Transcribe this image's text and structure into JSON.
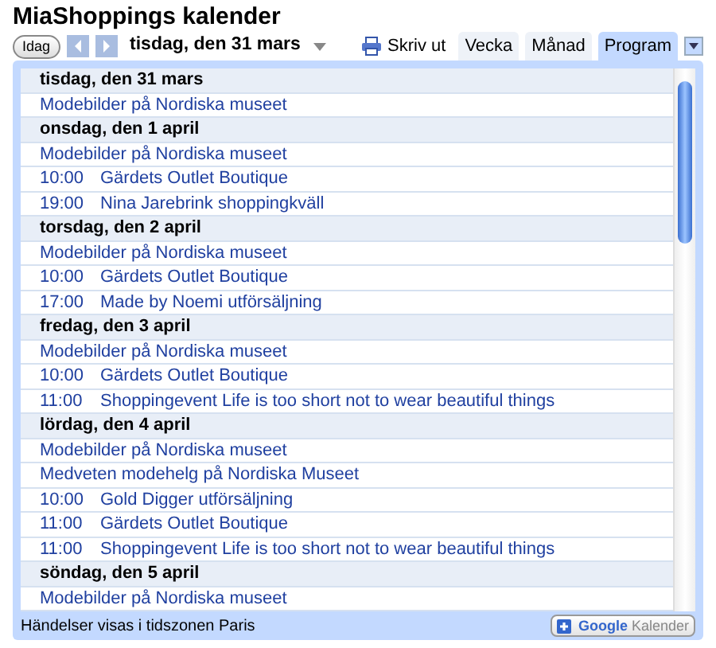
{
  "title": "MiaShoppings kalender",
  "toolbar": {
    "today_button": "Idag",
    "date_range": "tisdag, den 31 mars",
    "print_link": "Skriv ut"
  },
  "tabs": [
    {
      "label": "Vecka",
      "selected": false
    },
    {
      "label": "Månad",
      "selected": false
    },
    {
      "label": "Program",
      "selected": true
    }
  ],
  "days": [
    {
      "date": "tisdag, den 31 mars",
      "events": [
        {
          "title": "Modebilder på Nordiska museet"
        }
      ]
    },
    {
      "date": "onsdag, den 1 april",
      "events": [
        {
          "title": "Modebilder på Nordiska museet"
        },
        {
          "time": "10:00",
          "title": "Gärdets Outlet Boutique"
        },
        {
          "time": "19:00",
          "title": "Nina Jarebrink shoppingkväll"
        }
      ]
    },
    {
      "date": "torsdag, den 2 april",
      "events": [
        {
          "title": "Modebilder på Nordiska museet"
        },
        {
          "time": "10:00",
          "title": "Gärdets Outlet Boutique"
        },
        {
          "time": "17:00",
          "title": "Made by Noemi utförsäljning"
        }
      ]
    },
    {
      "date": "fredag, den 3 april",
      "events": [
        {
          "title": "Modebilder på Nordiska museet"
        },
        {
          "time": "10:00",
          "title": "Gärdets Outlet Boutique"
        },
        {
          "time": "11:00",
          "title": "Shoppingevent Life is too short not to wear beautiful things"
        }
      ]
    },
    {
      "date": "lördag, den 4 april",
      "events": [
        {
          "title": "Modebilder på Nordiska museet"
        },
        {
          "title": "Medveten modehelg på Nordiska Museet"
        },
        {
          "time": "10:00",
          "title": "Gold Digger utförsäljning"
        },
        {
          "time": "11:00",
          "title": "Gärdets Outlet Boutique"
        },
        {
          "time": "11:00",
          "title": "Shoppingevent Life is too short not to wear beautiful things"
        }
      ]
    },
    {
      "date": "söndag, den 5 april",
      "events": [
        {
          "title": "Modebilder på Nordiska museet"
        }
      ]
    }
  ],
  "footer": {
    "timezone_note": "Händelser visas i tidszonen Paris",
    "badge_brand": "Google",
    "badge_label": "Kalender"
  }
}
